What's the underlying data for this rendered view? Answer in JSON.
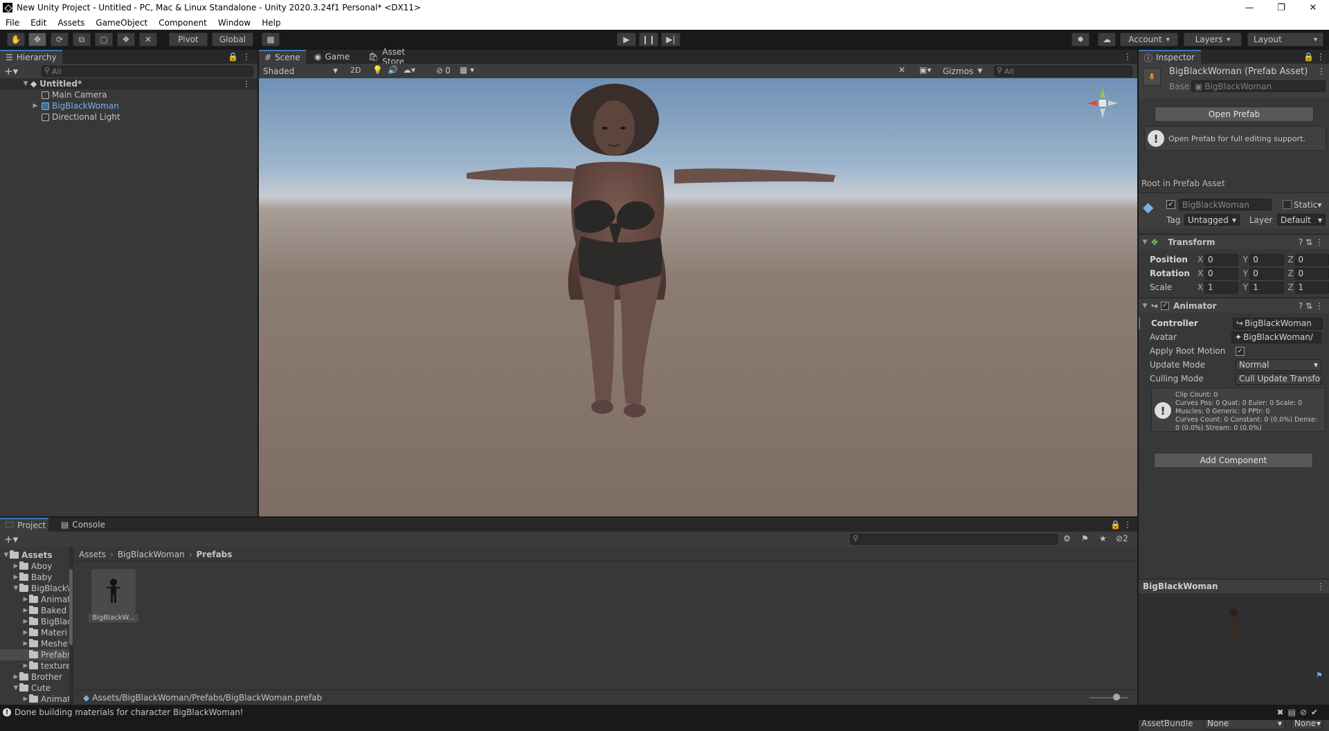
{
  "window": {
    "title": "New Unity Project - Untitled - PC, Mac & Linux Standalone - Unity 2020.3.24f1 Personal* <DX11>"
  },
  "menu": [
    "File",
    "Edit",
    "Assets",
    "GameObject",
    "Component",
    "Window",
    "Help"
  ],
  "toolbar": {
    "pivot": "Pivot",
    "global": "Global",
    "account": "Account",
    "layers": "Layers",
    "layout": "Layout"
  },
  "hierarchy": {
    "tab": "Hierarchy",
    "search_placeholder": "All",
    "scene": "Untitled*",
    "items": [
      "Main Camera",
      "BigBlackWoman",
      "Directional Light"
    ]
  },
  "scene_tabs": {
    "scene": "Scene",
    "game": "Game",
    "asset_store": "Asset Store"
  },
  "scene_toolbar": {
    "shading": "Shaded",
    "mode2d": "2D",
    "hidden_count": "0",
    "gizmos": "Gizmos",
    "search_placeholder": "All"
  },
  "inspector": {
    "tab": "Inspector",
    "asset_title": "BigBlackWoman (Prefab Asset)",
    "base_label": "Base",
    "base_value": "BigBlackWoman",
    "open_prefab": "Open Prefab",
    "open_prefab_help": "Open Prefab for full editing support.",
    "root_label": "Root in Prefab Asset",
    "object_name": "BigBlackWoman",
    "static_label": "Static",
    "tag_label": "Tag",
    "tag_value": "Untagged",
    "layer_label": "Layer",
    "layer_value": "Default",
    "transform": {
      "title": "Transform",
      "rows": [
        {
          "label": "Position",
          "x": "0",
          "y": "0",
          "z": "0"
        },
        {
          "label": "Rotation",
          "x": "0",
          "y": "0",
          "z": "0"
        },
        {
          "label": "Scale",
          "x": "1",
          "y": "1",
          "z": "1"
        }
      ]
    },
    "animator": {
      "title": "Animator",
      "controller_label": "Controller",
      "controller_value": "BigBlackWoman",
      "avatar_label": "Avatar",
      "avatar_value": "BigBlackWoman/",
      "apply_root_motion_label": "Apply Root Motion",
      "update_mode_label": "Update Mode",
      "update_mode_value": "Normal",
      "culling_mode_label": "Culling Mode",
      "culling_mode_value": "Cull Update Transfo",
      "info": [
        "Clip Count: 0",
        "Curves Pos: 0 Quat: 0 Euler: 0 Scale: 0",
        "Muscles: 0 Generic: 0 PPtr: 0",
        "Curves Count: 0 Constant: 0 (0.0%) Dense:",
        "0 (0.0%) Stream: 0 (0.0%)"
      ]
    },
    "add_component": "Add Component",
    "preview_title": "BigBlackWoman",
    "assetbundle_label": "AssetBundle",
    "assetbundle_value": "None",
    "assetbundle_variant": "None"
  },
  "project": {
    "tab": "Project",
    "console_tab": "Console",
    "hidden_count": "2",
    "tree": [
      {
        "label": "Assets",
        "depth": 0,
        "open": true,
        "bold": true
      },
      {
        "label": "Aboy",
        "depth": 1
      },
      {
        "label": "Baby",
        "depth": 1
      },
      {
        "label": "BigBlack\\",
        "depth": 1,
        "open": true
      },
      {
        "label": "Animat",
        "depth": 2
      },
      {
        "label": "Baked",
        "depth": 2
      },
      {
        "label": "BigBlac",
        "depth": 2
      },
      {
        "label": "Materi",
        "depth": 2
      },
      {
        "label": "Meshe",
        "depth": 2
      },
      {
        "label": "Prefabs",
        "depth": 2,
        "selected": true
      },
      {
        "label": "texture",
        "depth": 2
      },
      {
        "label": "Brother",
        "depth": 1
      },
      {
        "label": "Cute",
        "depth": 1,
        "open": true
      },
      {
        "label": "Animat",
        "depth": 2
      }
    ],
    "breadcrumb": [
      "Assets",
      "BigBlackWoman",
      "Prefabs"
    ],
    "asset_label": "BigBlackW...",
    "path": "Assets/BigBlackWoman/Prefabs/BigBlackWoman.prefab"
  },
  "status": {
    "message": "Done building materials for character BigBlackWoman!"
  },
  "colors": {
    "accent": "#3a79bb",
    "link_blue": "#7bafe6",
    "panel": "#383838",
    "toolbar": "#191919"
  }
}
